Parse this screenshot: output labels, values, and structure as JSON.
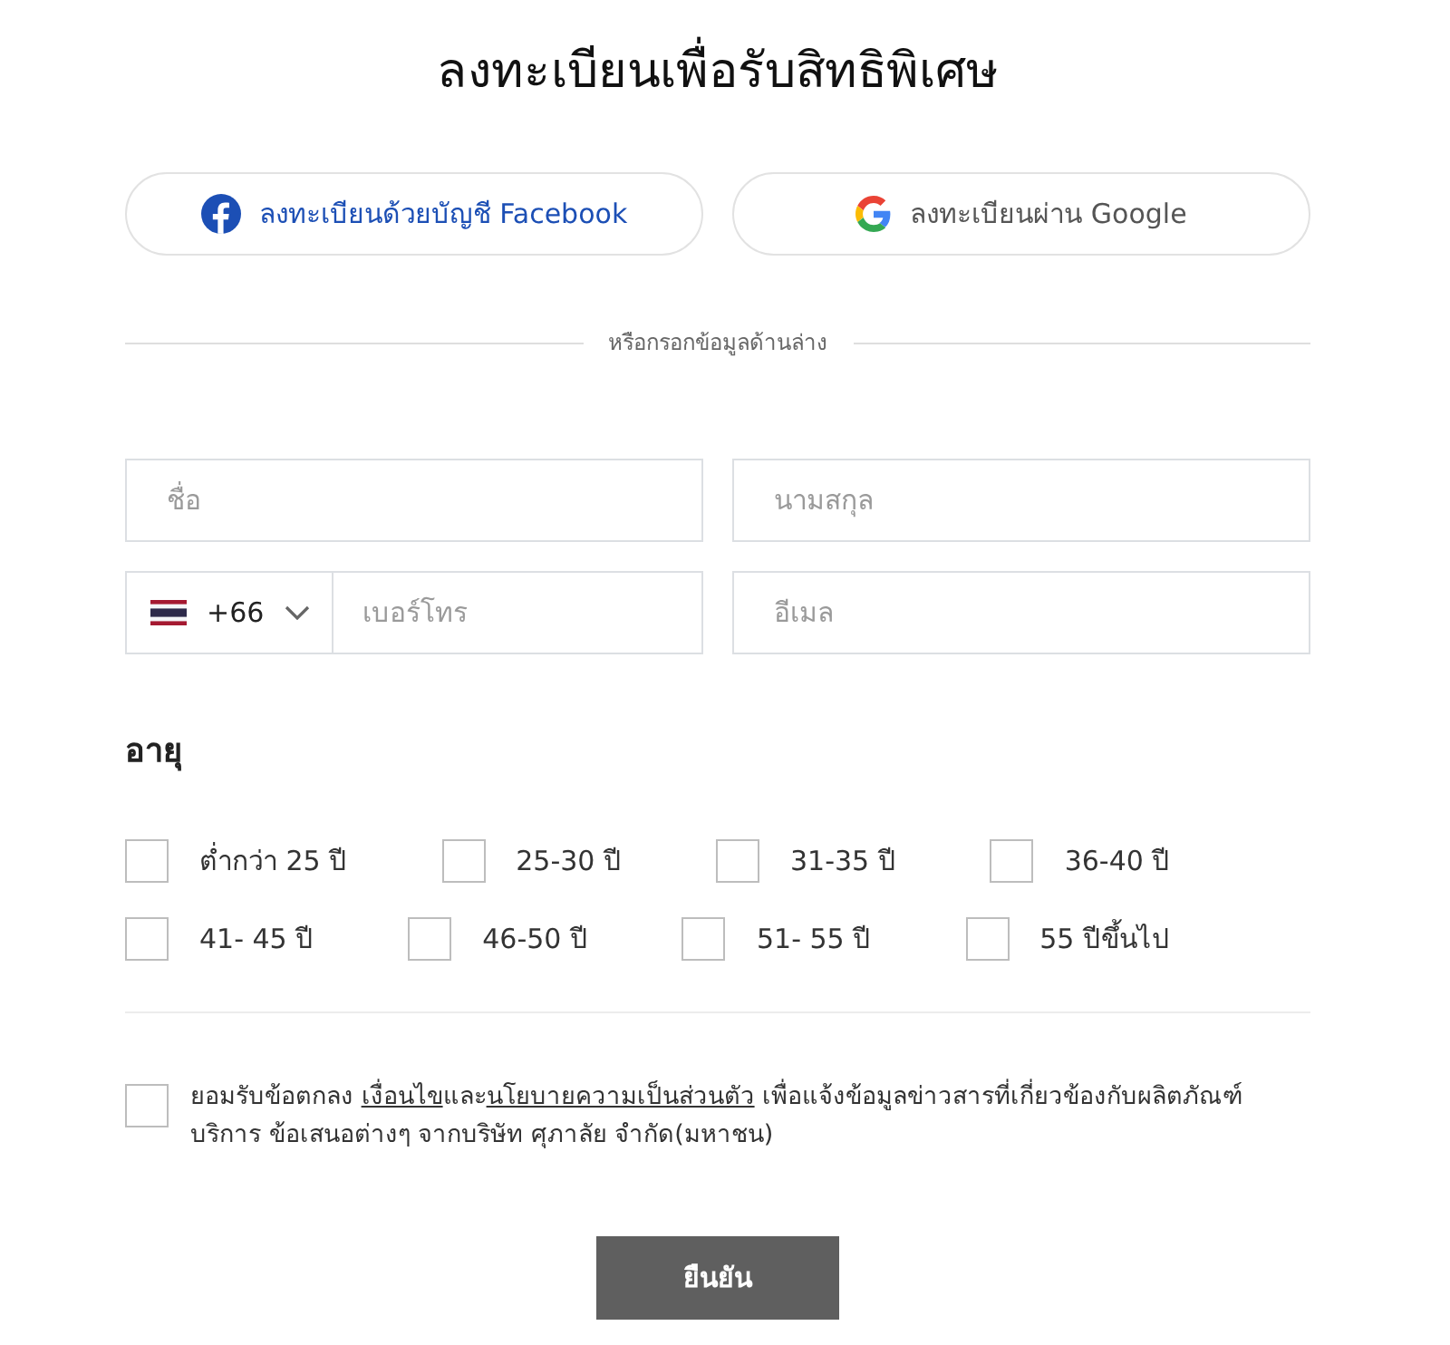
{
  "title": "ลงทะเบียนเพื่อรับสิทธิพิเศษ",
  "social_buttons": [
    {
      "kind": "facebook",
      "label": "ลงทะเบียนด้วยบัญชี Facebook"
    },
    {
      "kind": "google",
      "label": "ลงทะเบียนผ่าน Google"
    }
  ],
  "divider_text": "หรือกรอกข้อมูลด้านล่าง",
  "fields": {
    "first_name": {
      "placeholder": "ชื่อ"
    },
    "last_name": {
      "placeholder": "นามสกุล"
    },
    "phone": {
      "country_code": "+66",
      "placeholder": "เบอร์โทร"
    },
    "email": {
      "placeholder": "อีเมล"
    }
  },
  "age": {
    "heading": "อายุ",
    "options": [
      {
        "label": "ต่ำกว่า 25 ปี",
        "checked": false
      },
      {
        "label": "25-30 ปี",
        "checked": false
      },
      {
        "label": "31-35 ปี",
        "checked": false
      },
      {
        "label": "36-40 ปี",
        "checked": false
      },
      {
        "label": "41- 45 ปี",
        "checked": false
      },
      {
        "label": "46-50 ปี",
        "checked": false
      },
      {
        "label": "51- 55 ปี",
        "checked": false
      },
      {
        "label": "55 ปีขึ้นไป",
        "checked": false
      }
    ]
  },
  "consent": {
    "checked": false,
    "parts": [
      {
        "kind": "text",
        "text": "ยอมรับข้อตกลง "
      },
      {
        "kind": "link",
        "text": "เงื่อนไข"
      },
      {
        "kind": "text",
        "text": "และ"
      },
      {
        "kind": "link",
        "text": "นโยบายความเป็นส่วนตัว"
      },
      {
        "kind": "text",
        "text": " เพื่อแจ้งข้อมูลข่าวสารที่เกี่ยวข้องกับผลิตภัณฑ์ บริการ ข้อเสนอต่างๆ จากบริษัท ศุภาลัย จำกัด(มหาชน)"
      }
    ]
  },
  "submit_button": "ยืนยัน"
}
